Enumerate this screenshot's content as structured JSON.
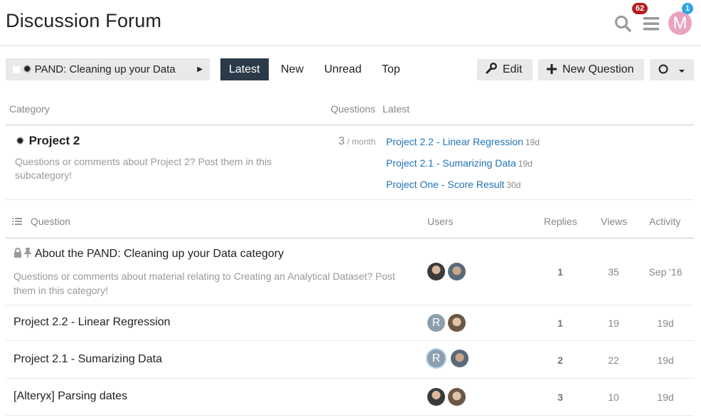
{
  "header": {
    "title": "Discussion Forum",
    "notification_count": "62",
    "avatar_letter": "M",
    "avatar_badge": "1",
    "colors": {
      "badge_red": "#b71c1c",
      "badge_blue": "#2fa4e7",
      "avatar": "#e8a4bf"
    }
  },
  "nav": {
    "category_label": "PAND: Cleaning up your Data",
    "tabs": [
      "Latest",
      "New",
      "Unread",
      "Top"
    ],
    "active_tab": "Latest",
    "edit_label": "Edit",
    "new_question_label": "New Question"
  },
  "category_table": {
    "headers": {
      "category": "Category",
      "questions": "Questions",
      "latest": "Latest"
    },
    "row": {
      "name": "Project 2",
      "description": "Questions or comments about Project 2? Post them in this subcategory!",
      "count": "3",
      "per": " / month",
      "latest": [
        {
          "title": "Project 2.2 - Linear Regression",
          "age": "19d"
        },
        {
          "title": "Project 2.1 - Sumarizing Data",
          "age": "19d"
        },
        {
          "title": "Project One - Score Result",
          "age": "30d"
        }
      ]
    }
  },
  "topic_list": {
    "headers": {
      "question": "Question",
      "users": "Users",
      "replies": "Replies",
      "views": "Views",
      "activity": "Activity"
    },
    "topics": [
      {
        "title": "About the PAND: Cleaning up your Data category",
        "excerpt": "Questions or comments about material relating to Creating an Analytical Dataset? Post them in this category!",
        "replies": "1",
        "views": "35",
        "activity": "Sep '16"
      },
      {
        "title": "Project 2.2 - Linear Regression",
        "replies": "1",
        "views": "19",
        "activity": "19d",
        "user_letter": "R"
      },
      {
        "title": "Project 2.1 - Sumarizing Data",
        "replies": "2",
        "views": "22",
        "activity": "19d",
        "user_letter": "R"
      },
      {
        "title": "[Alteryx] Parsing dates",
        "replies": "3",
        "views": "10",
        "activity": "19d"
      }
    ]
  }
}
